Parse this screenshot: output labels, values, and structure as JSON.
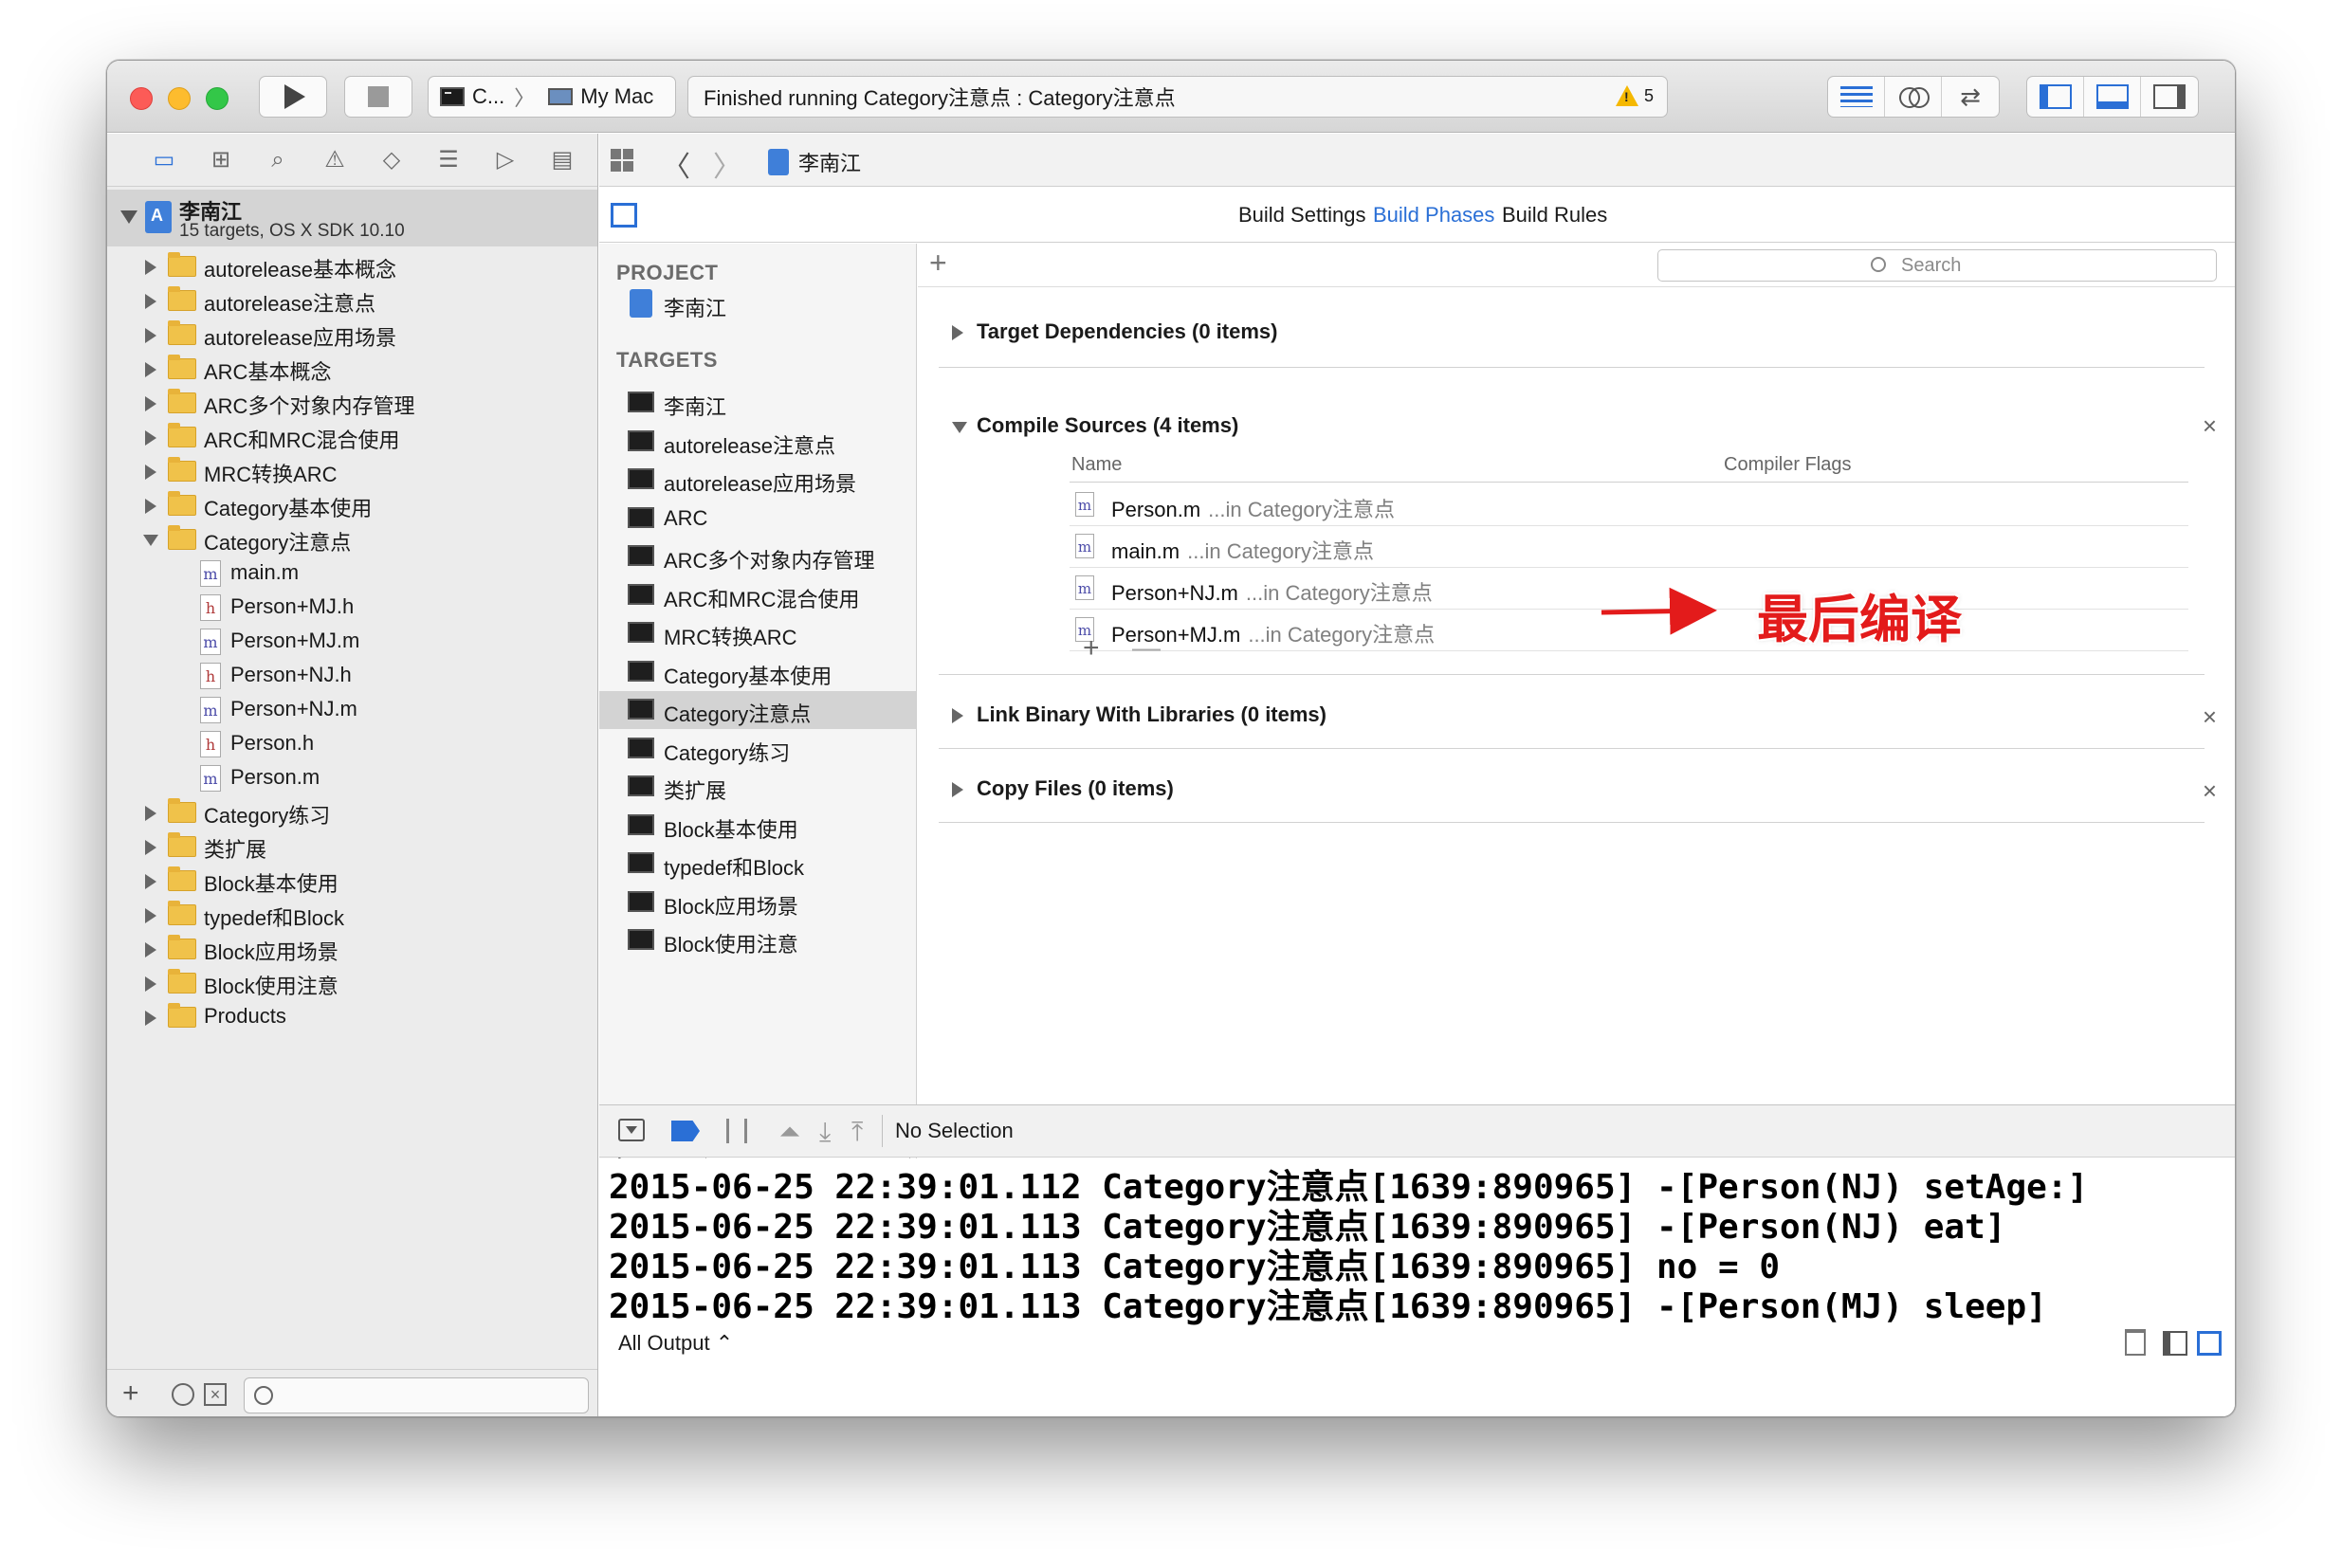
{
  "toolbar": {
    "scheme": "C...",
    "scheme_separator": "〉",
    "destination": "My Mac",
    "activity": "Finished running Category注意点 : Category注意点",
    "warning_count": "5"
  },
  "navigator": {
    "tabs": [
      "folder-icon",
      "hierarchy-icon",
      "search-icon",
      "warning-icon",
      "test-icon",
      "debug-icon",
      "breakpoint-icon",
      "report-icon"
    ],
    "project": {
      "name": "李南江",
      "subtitle": "15 targets, OS X SDK 10.10"
    },
    "items": [
      {
        "label": "autorelease基本概念",
        "type": "folder",
        "open": false
      },
      {
        "label": "autorelease注意点",
        "type": "folder",
        "open": false
      },
      {
        "label": "autorelease应用场景",
        "type": "folder",
        "open": false
      },
      {
        "label": "ARC基本概念",
        "type": "folder",
        "open": false
      },
      {
        "label": "ARC多个对象内存管理",
        "type": "folder",
        "open": false
      },
      {
        "label": "ARC和MRC混合使用",
        "type": "folder",
        "open": false
      },
      {
        "label": "MRC转换ARC",
        "type": "folder",
        "open": false
      },
      {
        "label": "Category基本使用",
        "type": "folder",
        "open": false
      },
      {
        "label": "Category注意点",
        "type": "folder",
        "open": true
      },
      {
        "label": "main.m",
        "type": "m"
      },
      {
        "label": "Person+MJ.h",
        "type": "h"
      },
      {
        "label": "Person+MJ.m",
        "type": "m"
      },
      {
        "label": "Person+NJ.h",
        "type": "h"
      },
      {
        "label": "Person+NJ.m",
        "type": "m"
      },
      {
        "label": "Person.h",
        "type": "h"
      },
      {
        "label": "Person.m",
        "type": "m"
      },
      {
        "label": "Category练习",
        "type": "folder",
        "open": false
      },
      {
        "label": "类扩展",
        "type": "folder",
        "open": false
      },
      {
        "label": "Block基本使用",
        "type": "folder",
        "open": false
      },
      {
        "label": "typedef和Block",
        "type": "folder",
        "open": false
      },
      {
        "label": "Block应用场景",
        "type": "folder",
        "open": false
      },
      {
        "label": "Block使用注意",
        "type": "folder",
        "open": false
      },
      {
        "label": "Products",
        "type": "folder",
        "open": false
      }
    ],
    "add_label": "+"
  },
  "jumpbar": {
    "crumb": "李南江",
    "back": "〈",
    "forward": "〉"
  },
  "settings_tabs": {
    "build_settings": "Build Settings",
    "build_phases": "Build Phases",
    "build_rules": "Build Rules"
  },
  "targets_panel": {
    "project_header": "PROJECT",
    "project_name": "李南江",
    "targets_header": "TARGETS",
    "targets": [
      "李南江",
      "autorelease注意点",
      "autorelease应用场景",
      "ARC",
      "ARC多个对象内存管理",
      "ARC和MRC混合使用",
      "MRC转换ARC",
      "Category基本使用",
      "Category注意点",
      "Category练习",
      "类扩展",
      "Block基本使用",
      "typedef和Block",
      "Block应用场景",
      "Block使用注意"
    ],
    "selected_index": 8,
    "add": "+",
    "remove": "—"
  },
  "phases": {
    "add": "+",
    "search_placeholder": "Search",
    "target_dependencies": "Target Dependencies (0 items)",
    "compile_sources": "Compile Sources (4 items)",
    "col_name": "Name",
    "col_flags": "Compiler Flags",
    "sources": [
      {
        "file": "Person.m",
        "path": "...in Category注意点"
      },
      {
        "file": "main.m",
        "path": "...in Category注意点"
      },
      {
        "file": "Person+NJ.m",
        "path": "...in Category注意点"
      },
      {
        "file": "Person+MJ.m",
        "path": "...in Category注意点"
      }
    ],
    "link_binary": "Link Binary With Libraries (0 items)",
    "copy_files": "Copy Files (0 items)",
    "close": "×",
    "row_add": "+",
    "row_remove": "—"
  },
  "annotation": {
    "text": "最后编译",
    "color": "#e31b1b"
  },
  "debug": {
    "no_selection": "No Selection",
    "console_lines": [
      "2015-06-25 22:39:01.112 Category注意点[1639:890965] -[Person(NJ) setAge:]",
      "2015-06-25 22:39:01.113 Category注意点[1639:890965] -[Person(NJ) eat]",
      "2015-06-25 22:39:01.113 Category注意点[1639:890965] no = 0",
      "2015-06-25 22:39:01.113 Category注意点[1639:890965] -[Person(MJ) sleep]"
    ],
    "output_selector": "All Output ⌃"
  },
  "colors": {
    "accent": "#2a6fd6",
    "warning": "#f5b800",
    "annotation": "#e31b1b"
  }
}
